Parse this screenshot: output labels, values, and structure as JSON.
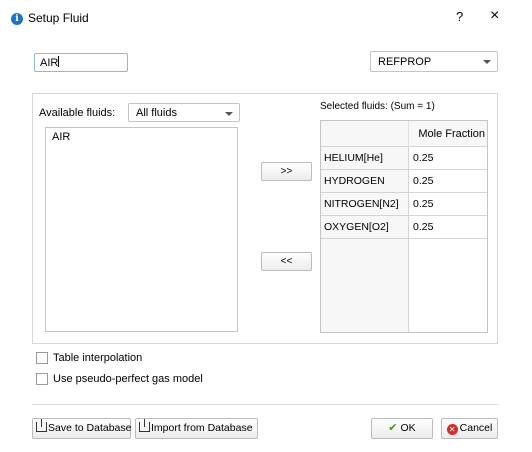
{
  "window": {
    "title": "Setup Fluid",
    "help_glyph": "?",
    "close_glyph": "×",
    "icon": "info-icon"
  },
  "fluid_name_input": {
    "value": "AIR"
  },
  "backend_select": {
    "selected": "REFPROP"
  },
  "available": {
    "label": "Available fluids:",
    "filter_selected": "All fluids",
    "items": [
      "AIR"
    ]
  },
  "transfer": {
    "add_label": ">>",
    "remove_label": "<<"
  },
  "selected": {
    "label": "Selected fluids: (Sum = 1)",
    "column_header": "Mole Fraction",
    "rows": [
      {
        "name": "HELIUM[He]",
        "fraction": "0.25"
      },
      {
        "name": "HYDROGEN",
        "fraction": "0.25"
      },
      {
        "name": "NITROGEN[N2]",
        "fraction": "0.25"
      },
      {
        "name": "OXYGEN[O2]",
        "fraction": "0.25"
      }
    ]
  },
  "options": {
    "table_interpolation": {
      "label": "Table interpolation",
      "checked": false
    },
    "pseudo_perfect": {
      "label": "Use pseudo-perfect gas model",
      "checked": false
    }
  },
  "footer": {
    "save_label": "Save to Database",
    "import_label": "Import from Database",
    "ok_label": "OK",
    "cancel_label": "Cancel"
  },
  "colors": {
    "accent": "#1f73c4",
    "ok_check": "#3a9a1e",
    "cancel_red": "#d52b2b",
    "input_border": "#8fb8e0"
  }
}
